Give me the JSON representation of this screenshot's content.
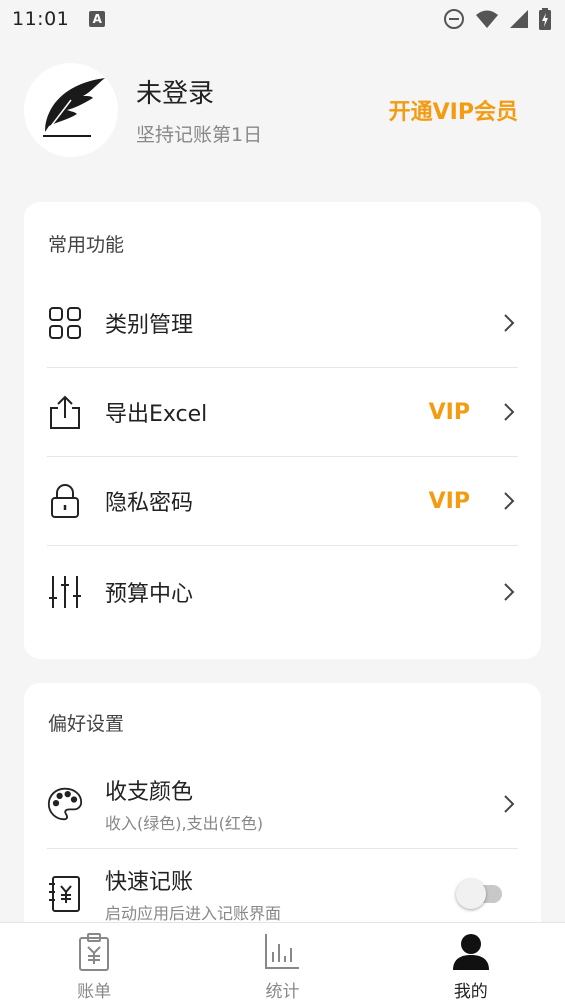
{
  "status_bar": {
    "time": "11:01",
    "notification_icon": "A",
    "icons": [
      "do-not-disturb-icon",
      "wifi-icon",
      "signal-icon",
      "battery-icon"
    ]
  },
  "profile": {
    "username": "未登录",
    "streak": "坚持记账第1日",
    "vip_link": "开通VIP会员",
    "avatar_icon": "feather-icon"
  },
  "common": {
    "title": "常用功能",
    "items": [
      {
        "label": "类别管理",
        "icon": "grid-icon",
        "vip": ""
      },
      {
        "label": "导出Excel",
        "icon": "export-icon",
        "vip": "VIP"
      },
      {
        "label": "隐私密码",
        "icon": "lock-icon",
        "vip": "VIP"
      },
      {
        "label": "预算中心",
        "icon": "sliders-icon",
        "vip": ""
      }
    ]
  },
  "preferences": {
    "title": "偏好设置",
    "items": [
      {
        "label": "收支颜色",
        "sub": "收入(绿色),支出(红色)",
        "icon": "palette-icon"
      },
      {
        "label": "快速记账",
        "sub": "启动应用后进入记账界面",
        "icon": "ledger-icon",
        "toggle": false
      }
    ]
  },
  "bottom_nav": [
    {
      "label": "账单",
      "icon": "bill-icon",
      "active": false
    },
    {
      "label": "统计",
      "icon": "chart-icon",
      "active": false
    },
    {
      "label": "我的",
      "icon": "person-icon",
      "active": true
    }
  ],
  "colors": {
    "accent": "#f39c12",
    "background": "#f5f5f5",
    "card": "#ffffff",
    "text": "#222222",
    "muted": "#888888"
  }
}
